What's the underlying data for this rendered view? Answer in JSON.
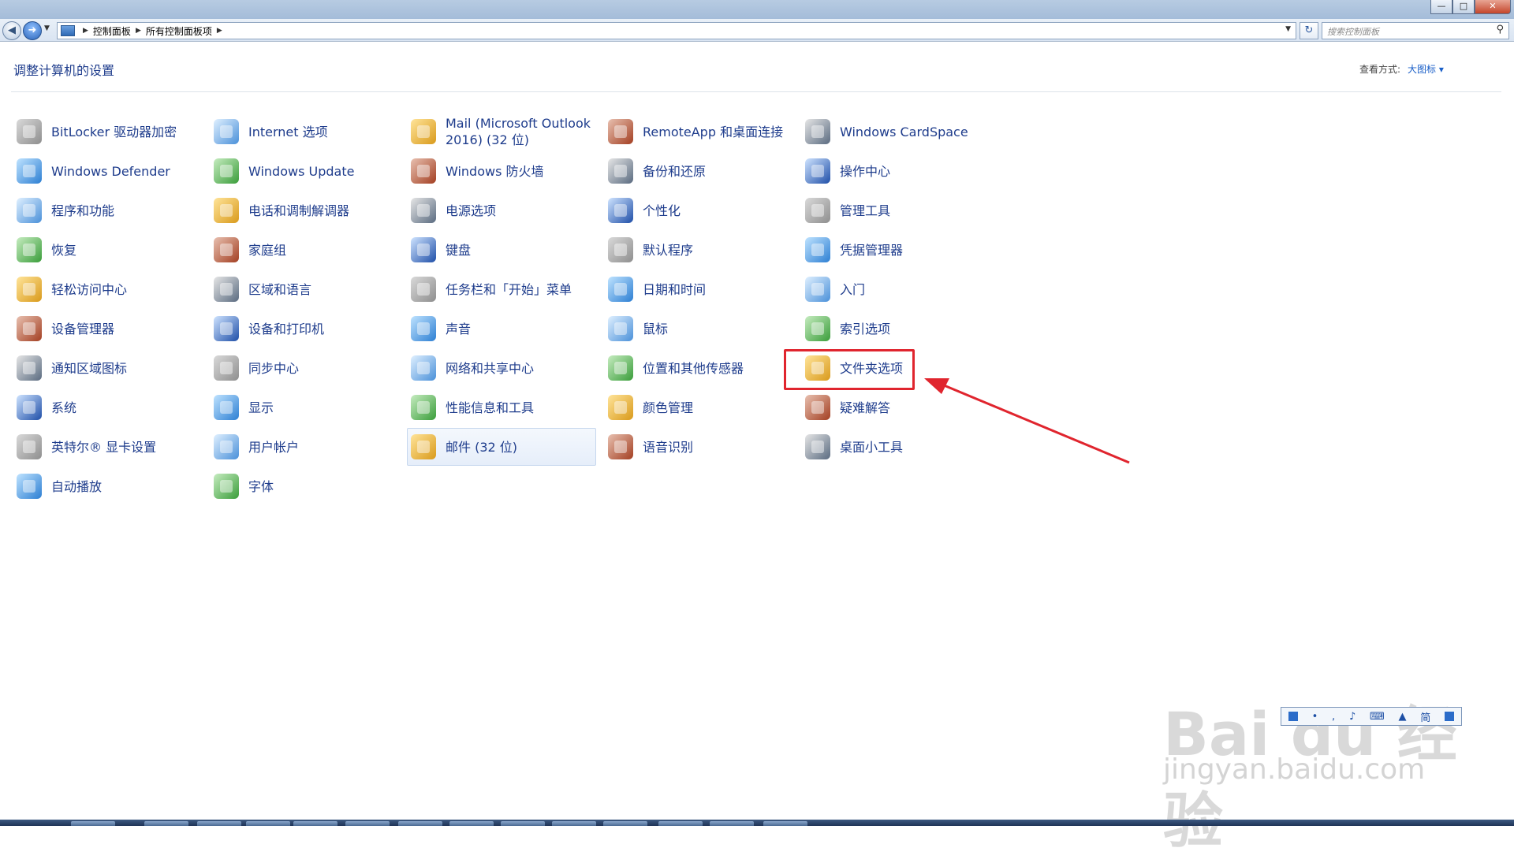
{
  "window": {
    "controls": {
      "minimize": "—",
      "maximize": "□",
      "close": "✕"
    }
  },
  "address": {
    "crumbs": [
      "控制面板",
      "所有控制面板项"
    ],
    "search_placeholder": "搜索控制面板"
  },
  "header": {
    "title": "调整计算机的设置",
    "view_by_label": "查看方式:",
    "view_by_value": "大图标 ▾"
  },
  "items": [
    {
      "label": "BitLocker 驱动器加密",
      "icon": "bitlocker-icon"
    },
    {
      "label": "Windows Defender",
      "icon": "defender-icon"
    },
    {
      "label": "程序和功能",
      "icon": "programs-icon"
    },
    {
      "label": "恢复",
      "icon": "recovery-icon"
    },
    {
      "label": "轻松访问中心",
      "icon": "ease-of-access-icon"
    },
    {
      "label": "设备管理器",
      "icon": "device-manager-icon"
    },
    {
      "label": "通知区域图标",
      "icon": "notification-icon"
    },
    {
      "label": "系统",
      "icon": "system-icon"
    },
    {
      "label": "英特尔® 显卡设置",
      "icon": "intel-graphics-icon"
    },
    {
      "label": "自动播放",
      "icon": "autoplay-icon"
    },
    {
      "label": "Internet 选项",
      "icon": "internet-options-icon"
    },
    {
      "label": "Windows Update",
      "icon": "windows-update-icon"
    },
    {
      "label": "电话和调制解调器",
      "icon": "phone-modem-icon"
    },
    {
      "label": "家庭组",
      "icon": "homegroup-icon"
    },
    {
      "label": "区域和语言",
      "icon": "region-language-icon"
    },
    {
      "label": "设备和打印机",
      "icon": "devices-printers-icon"
    },
    {
      "label": "同步中心",
      "icon": "sync-center-icon"
    },
    {
      "label": "显示",
      "icon": "display-icon"
    },
    {
      "label": "用户帐户",
      "icon": "user-accounts-icon"
    },
    {
      "label": "字体",
      "icon": "fonts-icon"
    },
    {
      "label": "Mail (Microsoft Outlook 2016) (32 位)",
      "icon": "mail-icon"
    },
    {
      "label": "Windows 防火墙",
      "icon": "firewall-icon"
    },
    {
      "label": "电源选项",
      "icon": "power-options-icon"
    },
    {
      "label": "键盘",
      "icon": "keyboard-icon"
    },
    {
      "label": "任务栏和「开始」菜单",
      "icon": "taskbar-icon"
    },
    {
      "label": "声音",
      "icon": "sound-icon"
    },
    {
      "label": "网络和共享中心",
      "icon": "network-icon"
    },
    {
      "label": "性能信息和工具",
      "icon": "performance-icon"
    },
    {
      "label": "邮件 (32 位)",
      "icon": "mail32-icon"
    },
    {
      "label": "RemoteApp 和桌面连接",
      "icon": "remoteapp-icon"
    },
    {
      "label": "备份和还原",
      "icon": "backup-icon"
    },
    {
      "label": "个性化",
      "icon": "personalization-icon"
    },
    {
      "label": "默认程序",
      "icon": "default-programs-icon"
    },
    {
      "label": "日期和时间",
      "icon": "date-time-icon"
    },
    {
      "label": "鼠标",
      "icon": "mouse-icon"
    },
    {
      "label": "位置和其他传感器",
      "icon": "location-sensors-icon"
    },
    {
      "label": "颜色管理",
      "icon": "color-management-icon"
    },
    {
      "label": "语音识别",
      "icon": "speech-icon"
    },
    {
      "label": "Windows CardSpace",
      "icon": "cardspace-icon"
    },
    {
      "label": "操作中心",
      "icon": "action-center-icon"
    },
    {
      "label": "管理工具",
      "icon": "admin-tools-icon"
    },
    {
      "label": "凭据管理器",
      "icon": "credential-manager-icon"
    },
    {
      "label": "入门",
      "icon": "getting-started-icon"
    },
    {
      "label": "索引选项",
      "icon": "indexing-icon"
    },
    {
      "label": "文件夹选项",
      "icon": "folder-options-icon"
    },
    {
      "label": "疑难解答",
      "icon": "troubleshooting-icon"
    },
    {
      "label": "桌面小工具",
      "icon": "gadgets-icon"
    }
  ],
  "watermark": {
    "logo": "Bai du 经验",
    "url": "jingyan.baidu.com",
    "toolbar_char": "简"
  }
}
